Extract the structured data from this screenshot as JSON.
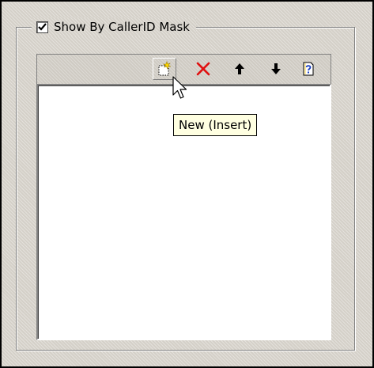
{
  "group": {
    "title": "Show By CallerID Mask",
    "checked": true
  },
  "toolbar": {
    "buttons": [
      {
        "name": "new",
        "icon": "new-item-icon"
      },
      {
        "name": "delete",
        "icon": "delete-x-icon"
      },
      {
        "name": "move-up",
        "icon": "arrow-up-icon"
      },
      {
        "name": "move-down",
        "icon": "arrow-down-icon"
      },
      {
        "name": "help",
        "icon": "help-icon"
      }
    ]
  },
  "tooltip": {
    "text": "New (Insert)"
  },
  "list": {
    "items": []
  },
  "colors": {
    "background": "#d4d0c8",
    "tooltip_bg": "#ffffe1",
    "delete_red": "#e01010"
  }
}
